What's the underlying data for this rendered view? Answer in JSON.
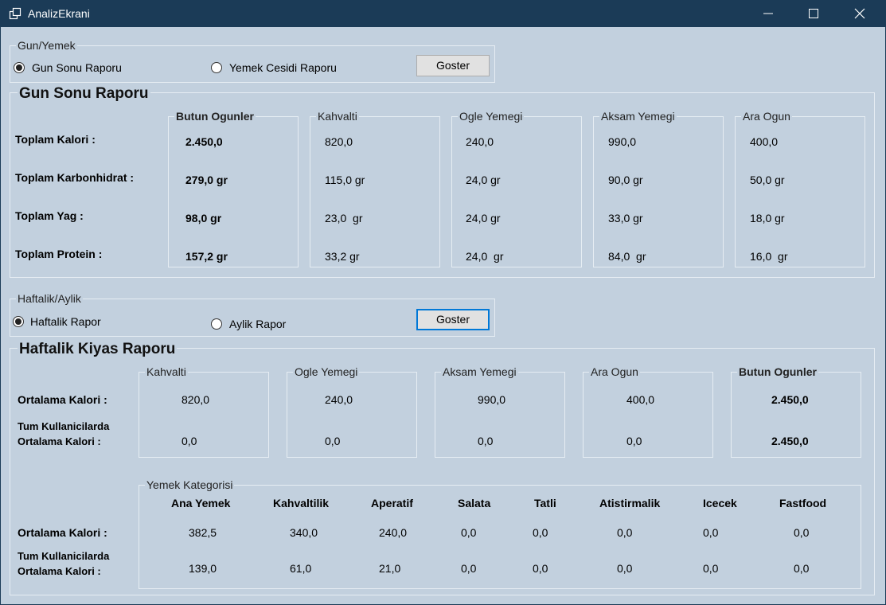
{
  "window": {
    "title": "AnalizEkrani"
  },
  "gun_yemek": {
    "caption": "Gun/Yemek",
    "radio1": "Gun Sonu Raporu",
    "radio2": "Yemek Cesidi Raporu",
    "button": "Goster"
  },
  "gun_sonu": {
    "title": "Gun Sonu Raporu",
    "row_labels": [
      "Toplam Kalori :",
      "Toplam Karbonhidrat :",
      "Toplam Yag :",
      "Toplam Protein :"
    ],
    "columns": [
      {
        "header": "Butun Ogunler",
        "values": [
          "2.450,0",
          "279,0 gr",
          "98,0 gr",
          "157,2 gr"
        ]
      },
      {
        "header": "Kahvalti",
        "values": [
          "820,0",
          "115,0 gr",
          "23,0  gr",
          "33,2 gr"
        ]
      },
      {
        "header": "Ogle Yemegi",
        "values": [
          "240,0",
          "24,0 gr",
          "24,0 gr",
          "24,0  gr"
        ]
      },
      {
        "header": "Aksam Yemegi",
        "values": [
          "990,0",
          "90,0 gr",
          "33,0 gr",
          "84,0  gr"
        ]
      },
      {
        "header": "Ara Ogun",
        "values": [
          "400,0",
          "50,0 gr",
          "18,0 gr",
          "16,0  gr"
        ]
      }
    ]
  },
  "haftalik_aylik": {
    "caption": "Haftalik/Aylik",
    "radio1": "Haftalik Rapor",
    "radio2": "Aylik Rapor",
    "button": "Goster"
  },
  "haftalik_kiyas": {
    "title": "Haftalik Kiyas Raporu",
    "row1_label": "Ortalama Kalori  :",
    "row2_label_line1": "Tum Kullanicilarda",
    "row2_label_line2": "Ortalama Kalori  :",
    "columns": [
      {
        "header": "Kahvalti",
        "values": [
          "820,0",
          "0,0"
        ]
      },
      {
        "header": "Ogle Yemegi",
        "values": [
          "240,0",
          "0,0"
        ]
      },
      {
        "header": "Aksam Yemegi",
        "values": [
          "990,0",
          "0,0"
        ]
      },
      {
        "header": "Ara Ogun",
        "values": [
          "400,0",
          "0,0"
        ]
      },
      {
        "header": "Butun Ogunler",
        "values": [
          "2.450,0",
          "2.450,0"
        ]
      }
    ]
  },
  "kategori": {
    "caption": "Yemek Kategorisi",
    "row1_label": "Ortalama Kalori  :",
    "row2_label_line1": "Tum Kullanicilarda",
    "row2_label_line2": "Ortalama Kalori  :",
    "columns": [
      {
        "header": "Ana Yemek",
        "values": [
          "382,5",
          "139,0"
        ]
      },
      {
        "header": "Kahvaltilik",
        "values": [
          "340,0",
          "61,0"
        ]
      },
      {
        "header": "Aperatif",
        "values": [
          "240,0",
          "21,0"
        ]
      },
      {
        "header": "Salata",
        "values": [
          "0,0",
          "0,0"
        ]
      },
      {
        "header": "Tatli",
        "values": [
          "0,0",
          "0,0"
        ]
      },
      {
        "header": "Atistirmalik",
        "values": [
          "0,0",
          "0,0"
        ]
      },
      {
        "header": "Icecek",
        "values": [
          "0,0",
          "0,0"
        ]
      },
      {
        "header": "Fastfood",
        "values": [
          "0,0",
          "0,0"
        ]
      }
    ]
  }
}
